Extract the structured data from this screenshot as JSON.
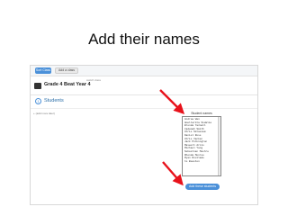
{
  "slide": {
    "title": "Add their names"
  },
  "app": {
    "toolbar": {
      "primary_button": "Sort Class",
      "secondary_button": "Add a class"
    },
    "class_header": {
      "caption": "switch class",
      "title": "Grade 4 Beat Year 4"
    },
    "students_section": {
      "step_number": "1",
      "label": "Students",
      "side_note": "+ (add more later)"
    },
    "names_panel": {
      "header": "Student names",
      "names": [
        "Andrew Wan",
        "Amellarita Sidalio",
        "Brenda Yazmall",
        "Cademah Smith",
        "Chris Sitaeiam",
        "Daniel Rose",
        "Chris Vacken",
        "Jack Pilkington",
        "Maxwell Arcis",
        "Michael Yang",
        "Sebastian Mashro",
        "Rhonda Monroe",
        "Ryan Riullade",
        "to Beaston"
      ]
    },
    "add_button": "Add these students"
  },
  "annotations": {
    "arrow_color": "#e8121b"
  }
}
